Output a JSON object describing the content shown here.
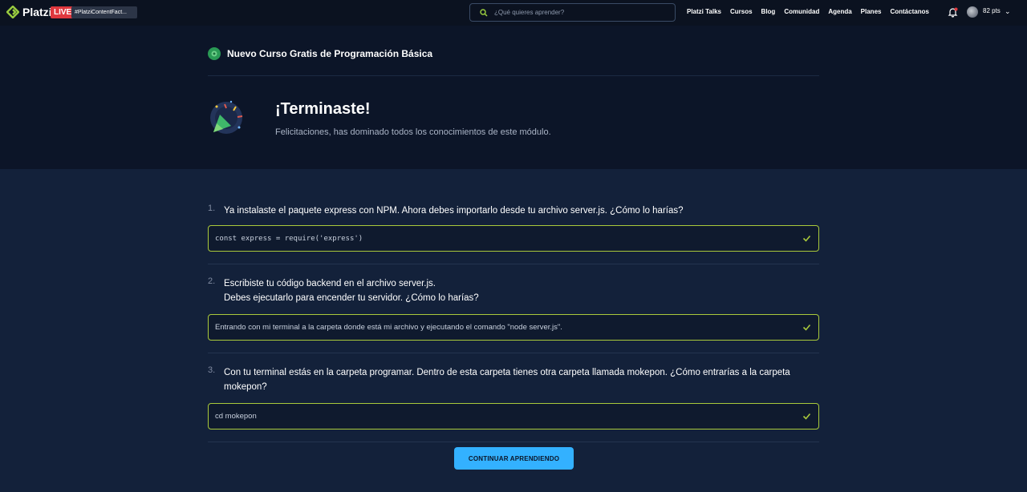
{
  "topbar": {
    "brand": "Platzi",
    "live_badge": "LIVE",
    "live_tag": "#PlatziContentFact...",
    "search_placeholder": "¿Qué quieres aprender?",
    "nav": [
      "Platzi Talks",
      "Cursos",
      "Blog",
      "Comunidad",
      "Agenda",
      "Planes",
      "Contáctanos"
    ],
    "points": "82 pts"
  },
  "hero": {
    "course_title": "Nuevo Curso Gratis de Programación Básica",
    "done_title": "¡Terminaste!",
    "done_subtitle": "Felicitaciones, has dominado todos los conocimientos de este módulo."
  },
  "questions": [
    {
      "number": "1.",
      "lines": [
        "Ya instalaste el paquete express con NPM. Ahora debes importarlo desde tu archivo server.js. ¿Cómo lo harías?"
      ],
      "answer": "const express = require('express')"
    },
    {
      "number": "2.",
      "lines": [
        "Escribiste tu código backend en el archivo server.js.",
        "Debes ejecutarlo para encender tu servidor. ¿Cómo lo harías?"
      ],
      "answer": "Entrando con mi terminal a la carpeta donde está mi archivo y ejecutando el comando \"node server.js\"."
    },
    {
      "number": "3.",
      "lines": [
        "Con tu terminal estás en la carpeta programar. Dentro de esta carpeta tienes otra carpeta llamada mokepon. ¿Cómo entrarías a la carpeta",
        "mokepon?"
      ],
      "answer": "cd mokepon"
    }
  ],
  "continue_label": "CONTINUAR APRENDIENDO",
  "colors": {
    "background": "#13213a",
    "topbar": "#0b1220",
    "hero": "#0c1528",
    "answer_border": "#a9c93b",
    "button": "#33b1ff",
    "live": "#e0383e"
  }
}
